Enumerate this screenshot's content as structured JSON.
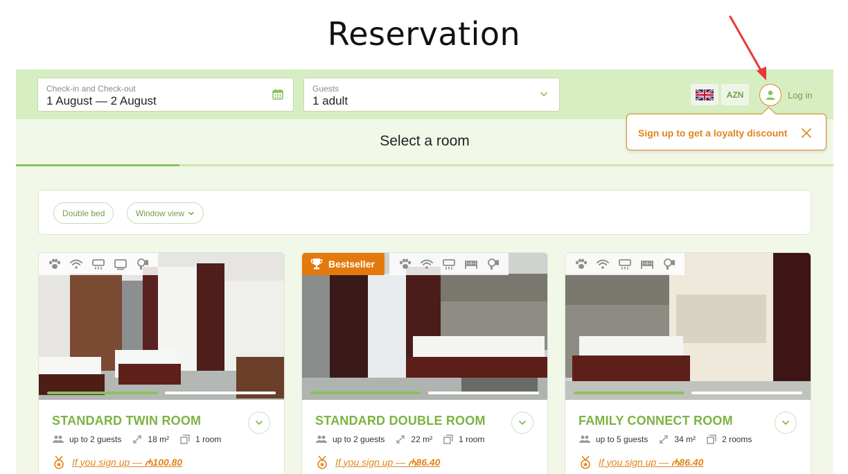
{
  "page": {
    "title": "Reservation"
  },
  "search": {
    "dates_label": "Check-in and Check-out",
    "dates_value": "1 August — 2 August",
    "guests_label": "Guests",
    "guests_value": "1 adult"
  },
  "header": {
    "language_flag": "uk-flag-icon",
    "currency": "AZN",
    "login_label": "Log in"
  },
  "popup": {
    "text": "Sign up to get a loyalty discount"
  },
  "section": {
    "title": "Select a room"
  },
  "filters": [
    {
      "label": "Double bed"
    },
    {
      "label": "Window view"
    }
  ],
  "rooms": [
    {
      "name": "STANDARD TWIN ROOM",
      "guests": "up to 2 guests",
      "area": "18 m²",
      "rooms": "1 room",
      "promo_text": "If you sign up — ",
      "promo_price": "₼100.80",
      "badge": "",
      "amenities": [
        "paw-icon",
        "wifi-icon",
        "ac-icon",
        "tv-icon",
        "hairdryer-icon"
      ]
    },
    {
      "name": "STANDARD DOUBLE ROOM",
      "guests": "up to 2 guests",
      "area": "22 m²",
      "rooms": "1 room",
      "promo_text": "If you sign up — ",
      "promo_price": "₼86.40",
      "badge": "Bestseller",
      "amenities": [
        "paw-icon",
        "wifi-icon",
        "ac-icon",
        "bed-icon",
        "hairdryer-icon"
      ]
    },
    {
      "name": "FAMILY CONNECT ROOM",
      "guests": "up to 5 guests",
      "area": "34 m²",
      "rooms": "2 rooms",
      "promo_text": "If you sign up — ",
      "promo_price": "₼86.40",
      "badge": "",
      "amenities": [
        "paw-icon",
        "wifi-icon",
        "ac-icon",
        "bed-icon",
        "hairdryer-icon"
      ]
    }
  ],
  "colors": {
    "accent_green": "#7cb342",
    "topbar_green": "#d7eec2",
    "background_green": "#f1f8e8",
    "orange": "#e0841c",
    "annotation_red": "#e53935"
  }
}
